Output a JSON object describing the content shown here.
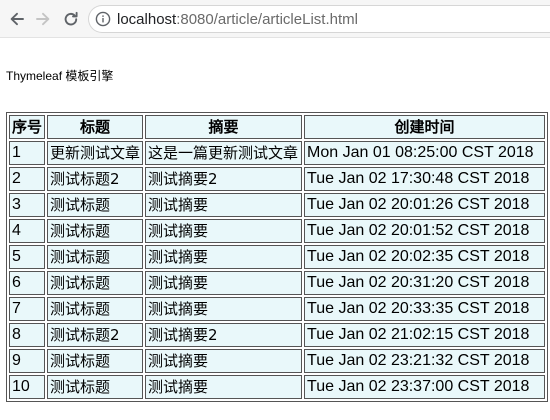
{
  "browser": {
    "url_host": "localhost",
    "url_rest": ":8080/article/articleList.html",
    "back_icon": "back-arrow-icon",
    "forward_icon": "forward-arrow-icon",
    "reload_icon": "reload-icon",
    "info_icon": "info-icon"
  },
  "page": {
    "heading": "Thymeleaf 模板引擎"
  },
  "table": {
    "headers": [
      "序号",
      "标题",
      "摘要",
      "创建时间"
    ],
    "rows": [
      {
        "id": "1",
        "title": "更新测试文章",
        "summary": "这是一篇更新测试文章",
        "created": "Mon Jan 01 08:25:00 CST 2018"
      },
      {
        "id": "2",
        "title": "测试标题2",
        "summary": "测试摘要2",
        "created": "Tue Jan 02 17:30:48 CST 2018"
      },
      {
        "id": "3",
        "title": "测试标题",
        "summary": "测试摘要",
        "created": "Tue Jan 02 20:01:26 CST 2018"
      },
      {
        "id": "4",
        "title": "测试标题",
        "summary": "测试摘要",
        "created": "Tue Jan 02 20:01:52 CST 2018"
      },
      {
        "id": "5",
        "title": "测试标题",
        "summary": "测试摘要",
        "created": "Tue Jan 02 20:02:35 CST 2018"
      },
      {
        "id": "6",
        "title": "测试标题",
        "summary": "测试摘要",
        "created": "Tue Jan 02 20:31:20 CST 2018"
      },
      {
        "id": "7",
        "title": "测试标题",
        "summary": "测试摘要",
        "created": "Tue Jan 02 20:33:35 CST 2018"
      },
      {
        "id": "8",
        "title": "测试标题2",
        "summary": "测试摘要2",
        "created": "Tue Jan 02 21:02:15 CST 2018"
      },
      {
        "id": "9",
        "title": "测试标题",
        "summary": "测试摘要",
        "created": "Tue Jan 02 23:21:32 CST 2018"
      },
      {
        "id": "10",
        "title": "测试标题",
        "summary": "测试摘要",
        "created": "Tue Jan 02 23:37:00 CST 2018"
      }
    ]
  }
}
